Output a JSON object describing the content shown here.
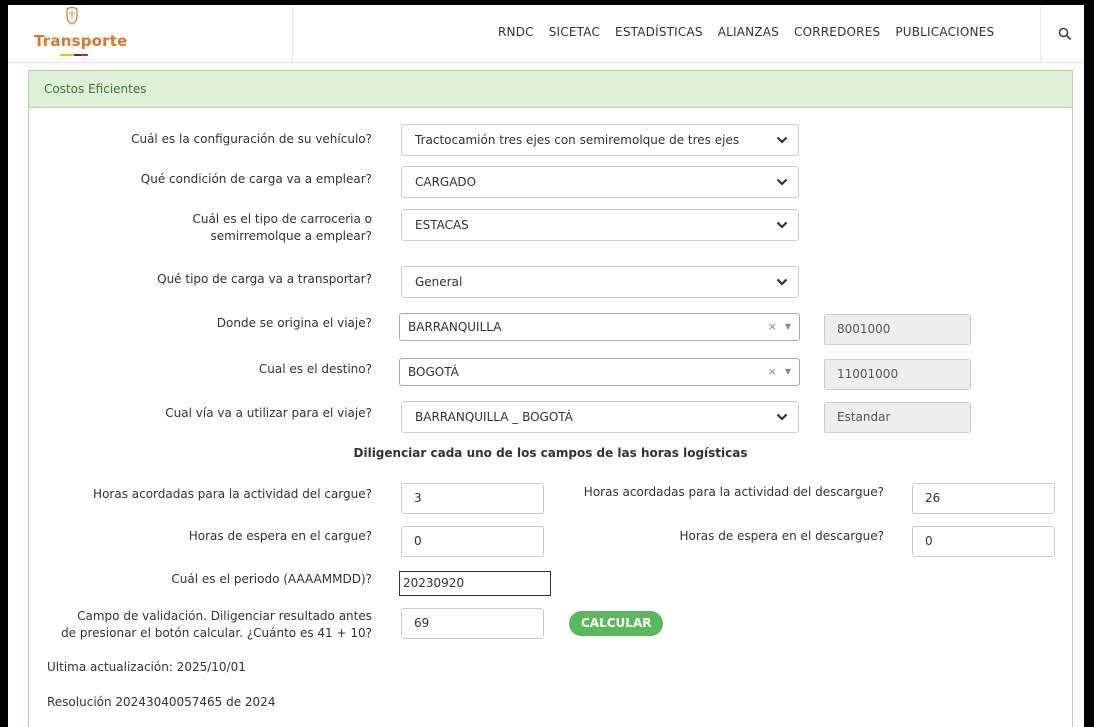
{
  "header": {
    "brand": "Transporte",
    "nav": [
      "RNDC",
      "SICETAC",
      "ESTADÍSTICAS",
      "ALIANZAS",
      "CORREDORES",
      "PUBLICACIONES"
    ]
  },
  "panel": {
    "title": "Costos Eficientes"
  },
  "form": {
    "vehicle_config": {
      "label": "Cuál es la configuración de su vehículo?",
      "value": "Tractocamión tres ejes con semiremolque de tres ejes"
    },
    "load_condition": {
      "label": "Qué condición de carga va a emplear?",
      "value": "CARGADO"
    },
    "body_type": {
      "label": "Cuál es el tipo de carroceria o semirremolque a emplear?",
      "value": "ESTACAS"
    },
    "cargo_type": {
      "label": "Qué tipo de carga va a transportar?",
      "value": "General"
    },
    "origin": {
      "label": "Donde se origina el viaje?",
      "value": "BARRANQUILLA",
      "code": "8001000"
    },
    "destination": {
      "label": "Cual es el destino?",
      "value": "BOGOTÁ",
      "code": "11001000"
    },
    "route": {
      "label": "Cual vía va a utilizar para el viaje?",
      "value": "BARRANQUILLA _ BOGOTÁ",
      "type": "Estandar"
    },
    "logistics_title": "Diligenciar cada uno de los campos de las horas logísticas",
    "load_hours": {
      "label": "Horas acordadas para la actividad del cargue?",
      "value": "3"
    },
    "unload_hours": {
      "label": "Horas acordadas para la actividad del descargue?",
      "value": "26"
    },
    "load_wait": {
      "label": "Horas de espera en el cargue?",
      "value": "0"
    },
    "unload_wait": {
      "label": "Horas de espera en el descargue?",
      "value": "0"
    },
    "period": {
      "label": "Cuál es el periodo (AAAAMMDD)?",
      "value": "20230920"
    },
    "validation": {
      "label": "Campo de validación. Diligenciar resultado antes de presionar el botón calcular. ¿Cuánto es 41 + 10?",
      "value": "69"
    },
    "calculate_label": "CALCULAR"
  },
  "footer": {
    "last_update": "Ultima actualización: 2025/10/01",
    "resolution": "Resolución 20243040057465 de 2024"
  },
  "colors": {
    "accent": "#5cb85c",
    "panel_head": "#dff0d8",
    "brand_orange": "#e0762a"
  }
}
